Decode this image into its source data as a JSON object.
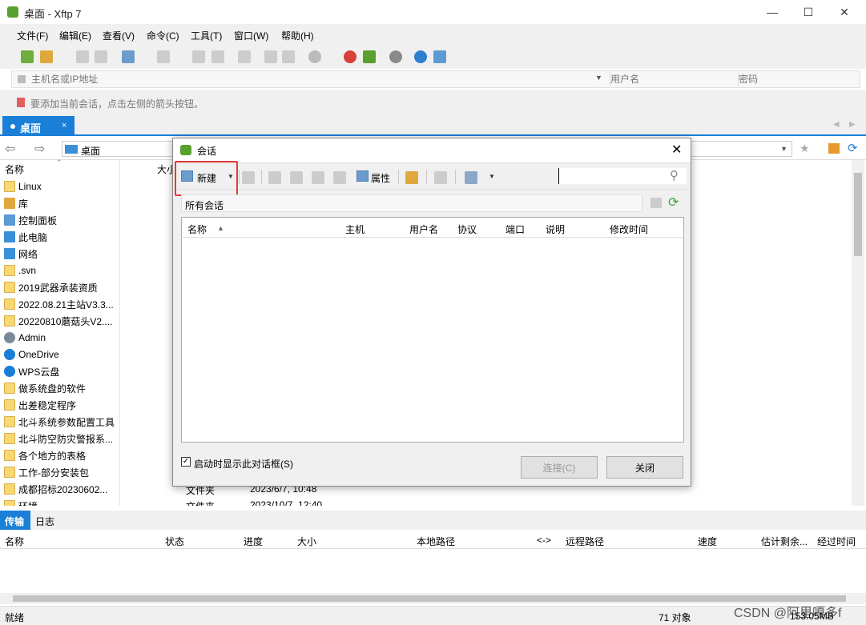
{
  "window": {
    "title": "桌面 - Xftp 7"
  },
  "menu": [
    "文件(F)",
    "编辑(E)",
    "查看(V)",
    "命令(C)",
    "工具(T)",
    "窗口(W)",
    "帮助(H)"
  ],
  "address": {
    "host_placeholder": "主机名或IP地址",
    "user_placeholder": "用户名",
    "password_placeholder": "密码"
  },
  "hint": "要添加当前会话，点击左侧的箭头按钮。",
  "tab": {
    "label": "桌面",
    "close": "×"
  },
  "nav": {
    "path": "桌面"
  },
  "left_panel": {
    "header_name": "名称",
    "header_size": "大小",
    "items": [
      {
        "name": "Linux",
        "icon": "folder-icon"
      },
      {
        "name": "库",
        "icon": "library-icon"
      },
      {
        "name": "控制面板",
        "icon": "control-panel-icon"
      },
      {
        "name": "此电脑",
        "icon": "computer-icon"
      },
      {
        "name": "网络",
        "icon": "network-icon"
      },
      {
        "name": ".svn",
        "icon": "folder-icon"
      },
      {
        "name": "2019武器承装资质",
        "icon": "folder-icon"
      },
      {
        "name": "2022.08.21主站V3.3...",
        "icon": "folder-icon"
      },
      {
        "name": "20220810蘑菇头V2....",
        "icon": "folder-icon"
      },
      {
        "name": "Admin",
        "icon": "user-icon"
      },
      {
        "name": "OneDrive",
        "icon": "cloud-icon"
      },
      {
        "name": "WPS云盘",
        "icon": "cloud-icon"
      },
      {
        "name": "做系统盘的软件",
        "icon": "folder-icon"
      },
      {
        "name": "出差稳定程序",
        "icon": "folder-icon"
      },
      {
        "name": "北斗系统参数配置工具",
        "icon": "folder-icon"
      },
      {
        "name": "北斗防空防灾警报系...",
        "icon": "folder-icon"
      },
      {
        "name": "各个地方的表格",
        "icon": "folder-icon"
      },
      {
        "name": "工作-部分安装包",
        "icon": "folder-icon"
      },
      {
        "name": "成都招标20230602...",
        "icon": "folder-icon"
      },
      {
        "name": "环境",
        "icon": "folder-icon"
      }
    ],
    "partial_rows": [
      {
        "type": "文件夹",
        "modified": "2023/6/7, 10:48"
      },
      {
        "type": "文件夹",
        "modified": "2023/10/7, 12:40"
      }
    ]
  },
  "dialog": {
    "title": "会话",
    "new_label": "新建",
    "properties_label": "属性",
    "folder_path": "所有会话",
    "columns": [
      "名称",
      "主机",
      "用户名",
      "协议",
      "端口",
      "说明",
      "修改时间"
    ],
    "checkbox_label": "启动时显示此对话框(S)",
    "connect_label": "连接(C)",
    "close_label": "关闭"
  },
  "bottom_panel": {
    "tabs": [
      "传输",
      "日志"
    ],
    "columns": [
      "名称",
      "状态",
      "进度",
      "大小",
      "本地路径",
      "<->",
      "远程路径",
      "速度",
      "估计剩余...",
      "经过时间"
    ]
  },
  "status": {
    "left": "就绪",
    "objects": "71 对象",
    "size": "153.05MB",
    "watermark": "CSDN @阿里嘎多f"
  },
  "colors": {
    "accent": "#1a7fd6",
    "highlight": "#e53935",
    "brand": "#5aa02c"
  }
}
